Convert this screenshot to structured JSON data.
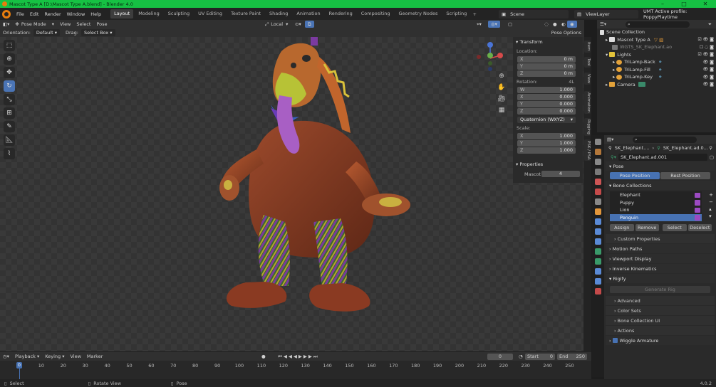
{
  "window": {
    "title": "Mascot Type A [D:\\Mascot Type A.blend] - Blender 4.0"
  },
  "menu": [
    "File",
    "Edit",
    "Render",
    "Window",
    "Help"
  ],
  "workspaces": [
    "Layout",
    "Modeling",
    "Sculpting",
    "UV Editing",
    "Texture Paint",
    "Shading",
    "Animation",
    "Rendering",
    "Compositing",
    "Geometry Nodes",
    "Scripting"
  ],
  "scene": "Scene",
  "view_layer": "ViewLayer",
  "profile": "UMT Active profile: PoppyPlaytime",
  "viewport": {
    "mode": "Pose Mode",
    "header_menus": [
      "View",
      "Select",
      "Pose"
    ],
    "orientation_label": "Orientation:",
    "orientation_value": "Default",
    "drag_label": "Drag:",
    "drag_value": "Select Box",
    "transform_orientation": "Local",
    "pose_options": "Pose Options"
  },
  "npanel": {
    "transform": "Transform",
    "location_label": "Location:",
    "location": [
      {
        "k": "X",
        "v": "0 m"
      },
      {
        "k": "Y",
        "v": "0 m"
      },
      {
        "k": "Z",
        "v": "0 m"
      }
    ],
    "rotation_label": "Rotation:",
    "rotation_mode_short": "4L",
    "rotation": [
      {
        "k": "W",
        "v": "1.000"
      },
      {
        "k": "X",
        "v": "0.000"
      },
      {
        "k": "Y",
        "v": "0.000"
      },
      {
        "k": "Z",
        "v": "0.000"
      }
    ],
    "rotation_mode": "Quaternion (WXYZ)",
    "scale_label": "Scale:",
    "scale": [
      {
        "k": "X",
        "v": "1.000"
      },
      {
        "k": "Y",
        "v": "1.000"
      },
      {
        "k": "Z",
        "v": "1.000"
      }
    ],
    "properties": "Properties",
    "prop_name": "Mascot",
    "prop_value": "4"
  },
  "side_tabs": [
    "Item",
    "Tool",
    "View",
    "Animation",
    "Rigging",
    "PSK / PSA"
  ],
  "outliner": {
    "root": "Scene Collection",
    "items": [
      {
        "name": "Mascot Type A",
        "indent": 1
      },
      {
        "name": "WGTS_SK_Elephant.ao",
        "indent": 1
      },
      {
        "name": "Lights",
        "indent": 1
      },
      {
        "name": "TriLamp-Back",
        "indent": 2
      },
      {
        "name": "TriLamp-Fill",
        "indent": 2
      },
      {
        "name": "TriLamp-Key",
        "indent": 2
      },
      {
        "name": "Camera",
        "indent": 1
      }
    ]
  },
  "properties": {
    "breadcrumb_obj": "SK_Elephant....",
    "breadcrumb_arm": "SK_Elephant.ad.0...",
    "armature_name": "SK_Elephant.ad.001",
    "pose": "Pose",
    "pose_position": "Pose Position",
    "rest_position": "Rest Position",
    "bone_collections": "Bone Collections",
    "collections": [
      "Elephant",
      "Puppy",
      "Lion",
      "Penguin"
    ],
    "assign": "Assign",
    "remove": "Remove",
    "select": "Select",
    "deselect": "Deselect",
    "sections": [
      "Custom Properties",
      "Motion Paths",
      "Viewport Display",
      "Inverse Kinematics"
    ],
    "rigify": "Rigify",
    "generate_rig": "Generate Rig",
    "rigify_subs": [
      "Advanced",
      "Color Sets",
      "Bone Collection UI",
      "Actions"
    ],
    "wiggle": "Wiggle Armature"
  },
  "timeline": {
    "menus": [
      "Playback",
      "Keying",
      "View",
      "Marker"
    ],
    "current_frame": "0",
    "start_label": "Start",
    "start": "0",
    "end_label": "End",
    "end": "250",
    "ticks": [
      "0",
      "10",
      "20",
      "30",
      "40",
      "50",
      "60",
      "70",
      "80",
      "90",
      "100",
      "110",
      "120",
      "130",
      "140",
      "150",
      "160",
      "170",
      "180",
      "190",
      "200",
      "210",
      "220",
      "230",
      "240",
      "250"
    ]
  },
  "status": {
    "select": "Select",
    "rotate": "Rotate View",
    "pose": "Pose",
    "version": "4.0.2"
  }
}
